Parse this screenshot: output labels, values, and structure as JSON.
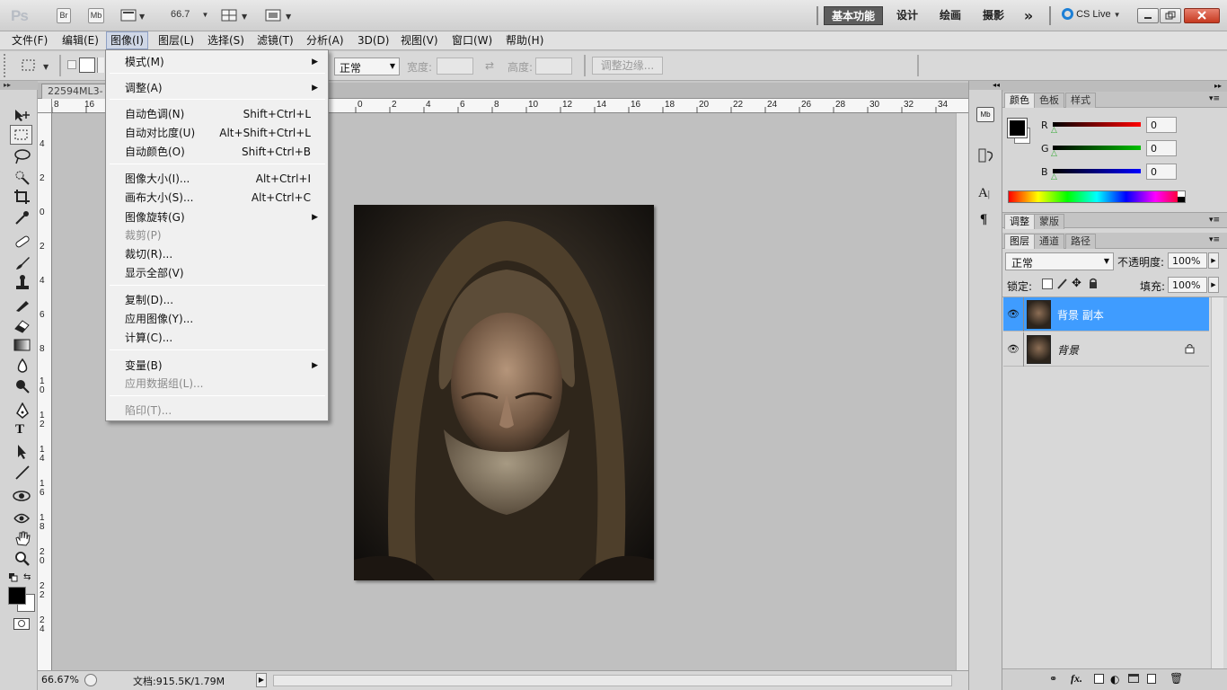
{
  "appbar": {
    "logo": "Ps",
    "bridge": "Br",
    "mini_bridge": "Mb",
    "zoom": "66.7",
    "workspaces": [
      "基本功能",
      "设计",
      "绘画",
      "摄影"
    ],
    "more": "»",
    "cs_live": "CS Live"
  },
  "menubar": {
    "items": [
      "文件(F)",
      "编辑(E)",
      "图像(I)",
      "图层(L)",
      "选择(S)",
      "滤镜(T)",
      "分析(A)",
      "3D(D)",
      "视图(V)",
      "窗口(W)",
      "帮助(H)"
    ]
  },
  "options": {
    "style_value": "正常",
    "width_label": "宽度:",
    "height_label": "高度:",
    "refine_edge": "调整边缘..."
  },
  "document": {
    "tab_title": "22594ML3-",
    "zoom_status": "66.67%",
    "doc_info": "文档:915.5K/1.79M"
  },
  "ruler": {
    "top": [
      "8",
      "16",
      "0",
      "2",
      "4",
      "6",
      "8",
      "10",
      "12",
      "14",
      "16",
      "18",
      "20",
      "22",
      "24",
      "26",
      "28",
      "30",
      "32",
      "34"
    ],
    "left": [
      "4",
      "2",
      "0",
      "2",
      "4",
      "6",
      "8",
      "10",
      "12",
      "14",
      "16",
      "18",
      "20",
      "22",
      "24"
    ]
  },
  "image_menu": {
    "items": [
      {
        "label": "模式(M)",
        "submenu": true
      },
      {
        "label": "调整(A)",
        "submenu": true
      },
      {
        "label": "自动色调(N)",
        "shortcut": "Shift+Ctrl+L"
      },
      {
        "label": "自动对比度(U)",
        "shortcut": "Alt+Shift+Ctrl+L"
      },
      {
        "label": "自动颜色(O)",
        "shortcut": "Shift+Ctrl+B"
      },
      {
        "label": "图像大小(I)...",
        "shortcut": "Alt+Ctrl+I"
      },
      {
        "label": "画布大小(S)...",
        "shortcut": "Alt+Ctrl+C"
      },
      {
        "label": "图像旋转(G)",
        "submenu": true
      },
      {
        "label": "裁剪(P)",
        "disabled": true
      },
      {
        "label": "裁切(R)..."
      },
      {
        "label": "显示全部(V)"
      },
      {
        "label": "复制(D)..."
      },
      {
        "label": "应用图像(Y)..."
      },
      {
        "label": "计算(C)..."
      },
      {
        "label": "变量(B)",
        "submenu": true
      },
      {
        "label": "应用数据组(L)...",
        "disabled": true
      },
      {
        "label": "陷印(T)...",
        "disabled": true
      }
    ]
  },
  "color_panel": {
    "tabs": [
      "颜色",
      "色板",
      "样式"
    ],
    "r_label": "R",
    "g_label": "G",
    "b_label": "B",
    "r": "0",
    "g": "0",
    "b": "0",
    "colors": {
      "r": "#ff0000",
      "g": "#00c000",
      "b": "#0000ff"
    }
  },
  "adjust_panel": {
    "tabs": [
      "调整",
      "蒙版"
    ]
  },
  "layers_panel": {
    "tabs": [
      "图层",
      "通道",
      "路径"
    ],
    "blend_mode": "正常",
    "opacity_label": "不透明度:",
    "opacity": "100%",
    "lock_label": "锁定:",
    "fill_label": "填充:",
    "fill": "100%",
    "layers": [
      {
        "name": "背景 副本",
        "selected": true
      },
      {
        "name": "背景",
        "locked": true
      }
    ],
    "selected_color": "#3f9cff"
  }
}
